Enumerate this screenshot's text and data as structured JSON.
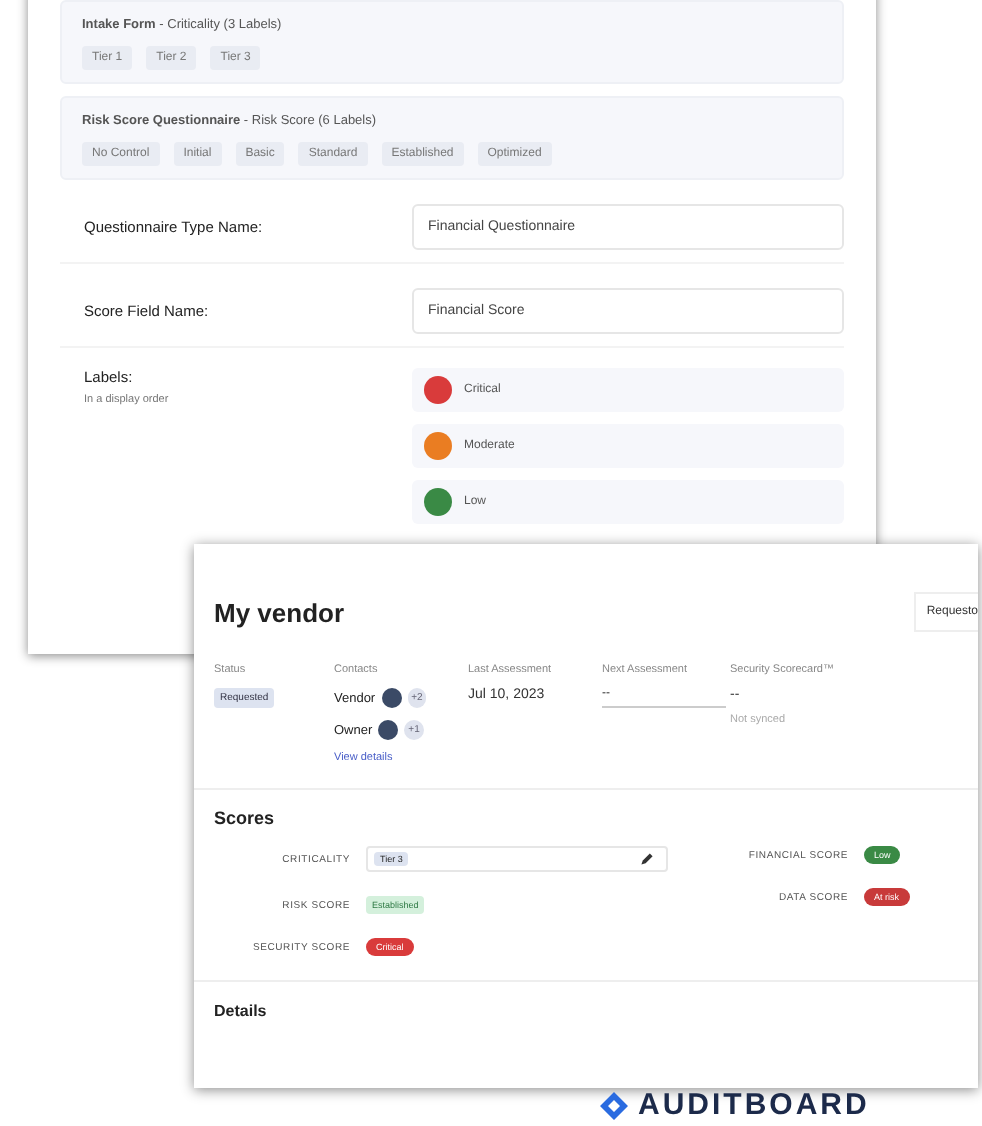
{
  "settings_card": {
    "groups": [
      {
        "title": "Intake Form",
        "subtitle": " - Criticality (3 Labels)",
        "chips": [
          "Tier 1",
          "Tier 2",
          "Tier 3"
        ]
      },
      {
        "title": "Risk Score Questionnaire",
        "subtitle": " - Risk Score (6 Labels)",
        "chips": [
          "No Control",
          "Initial",
          "Basic",
          "Standard",
          "Established",
          "Optimized"
        ]
      }
    ],
    "fields": [
      {
        "label": "Questionnaire Type Name:",
        "value": "Financial Questionnaire"
      },
      {
        "label": "Score Field Name:",
        "value": "Financial Score"
      }
    ],
    "labels_heading": "Labels:",
    "labels_hint": "In a display order",
    "labels": [
      {
        "name": "Critical",
        "color": "#d93b3b"
      },
      {
        "name": "Moderate",
        "color": "#ea7d22"
      },
      {
        "name": "Low",
        "color": "#3a8a45"
      }
    ]
  },
  "vendor_card": {
    "title": "My vendor",
    "header_button": "Requesto",
    "status_label": "Status",
    "status": "Requested",
    "contacts_label": "Contacts",
    "contacts": [
      {
        "role": "Vendor",
        "extra": "+2"
      },
      {
        "role": "Owner",
        "extra": "+1"
      }
    ],
    "view_details": "View details",
    "last_label": "Last Assessment",
    "last_value": "Jul 10, 2023",
    "next_label": "Next Assessment",
    "next_value": "--",
    "scorecard_label": "Security Scorecard™",
    "scorecard_value": "--",
    "scorecard_note": "Not synced",
    "scores_heading": "Scores",
    "scores_left": [
      {
        "label": "CRITICALITY",
        "kind": "field",
        "value": "Tier 3"
      },
      {
        "label": "RISK SCORE",
        "kind": "tag",
        "value": "Established",
        "color": "#d4f0dc"
      },
      {
        "label": "SECURITY SCORE",
        "kind": "badge",
        "value": "Critical",
        "color": "#d93b3b"
      }
    ],
    "scores_right": [
      {
        "label": "FINANCIAL SCORE",
        "kind": "badge",
        "value": "Low",
        "color": "#3a8a45"
      },
      {
        "label": "DATA SCORE",
        "kind": "badge",
        "value": "At risk",
        "color": "#c83a3a"
      }
    ],
    "details_heading": "Details"
  },
  "brand": "AUDITBOARD"
}
